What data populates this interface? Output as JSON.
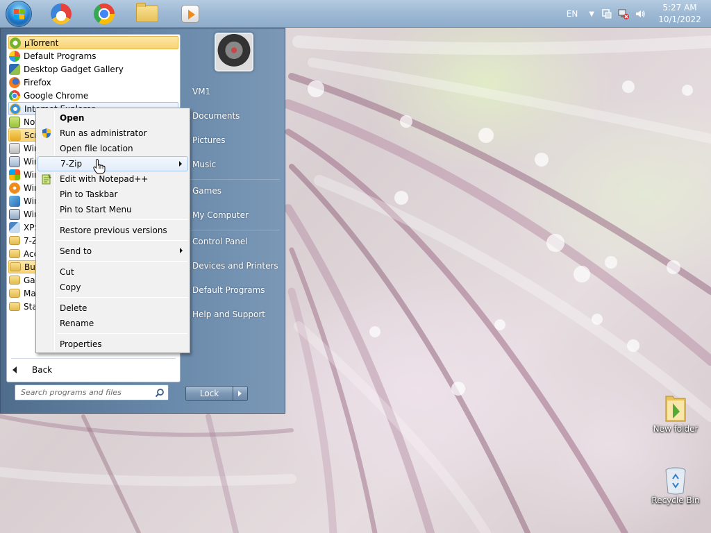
{
  "taskbar": {
    "apps": [
      {
        "name": "start-button",
        "icon": "windows-orb-icon"
      },
      {
        "name": "browser-lock-app",
        "icon": "lock-browser-icon"
      },
      {
        "name": "chrome-app",
        "icon": "chrome-icon"
      },
      {
        "name": "explorer-app",
        "icon": "folder-icon"
      },
      {
        "name": "media-player-app",
        "icon": "media-player-icon"
      }
    ],
    "tray": {
      "language": "EN",
      "time": "5:27 AM",
      "date": "10/1/2022",
      "icons": [
        "show-hidden-icons-chevron",
        "action-center-icon",
        "network-disconnected-icon",
        "volume-icon"
      ]
    }
  },
  "start_menu": {
    "programs": [
      {
        "label": "µTorrent",
        "icon": "utorrent-icon",
        "state": "highlighted"
      },
      {
        "label": "Default Programs",
        "icon": "default-programs-icon"
      },
      {
        "label": "Desktop Gadget Gallery",
        "icon": "gadget-gallery-icon"
      },
      {
        "label": "Firefox",
        "icon": "firefox-icon"
      },
      {
        "label": "Google Chrome",
        "icon": "chrome-icon"
      },
      {
        "label": "Internet Explorer",
        "icon": "internet-explorer-icon",
        "state": "selected"
      },
      {
        "label": "Not",
        "icon": "notepad-icon"
      },
      {
        "label": "Scr",
        "icon": "scratch-icon",
        "state": "highlighted"
      },
      {
        "label": "Win",
        "icon": "windows-app-icon"
      },
      {
        "label": "Win",
        "icon": "windows-app-icon"
      },
      {
        "label": "Win",
        "icon": "windows-app-icon"
      },
      {
        "label": "Win",
        "icon": "windows-media-icon"
      },
      {
        "label": "Win",
        "icon": "windows-app-icon"
      },
      {
        "label": "Win",
        "icon": "windows-app-icon"
      },
      {
        "label": "XPS",
        "icon": "xps-viewer-icon"
      },
      {
        "label": "7-Z",
        "icon": "folder-icon"
      },
      {
        "label": "Acc",
        "icon": "folder-icon"
      },
      {
        "label": "But",
        "icon": "folder-icon",
        "state": "highlighted"
      },
      {
        "label": "Gar",
        "icon": "folder-icon"
      },
      {
        "label": "Ma",
        "icon": "folder-icon"
      },
      {
        "label": "Sta",
        "icon": "folder-icon"
      }
    ],
    "back_label": "Back",
    "search_placeholder": "Search programs and files",
    "right_items": [
      {
        "label": "VM1"
      },
      {
        "label": "Documents"
      },
      {
        "label": "Pictures"
      },
      {
        "label": "Music"
      },
      {
        "label": "Games"
      },
      {
        "label": "My Computer"
      },
      {
        "label": "Control Panel"
      },
      {
        "label": "Devices and Printers"
      },
      {
        "label": "Default Programs"
      },
      {
        "label": "Help and Support"
      }
    ],
    "lock_label": "Lock"
  },
  "context_menu": {
    "items": [
      {
        "label": "Open",
        "bold": true
      },
      {
        "label": "Run as administrator",
        "icon": "uac-shield-icon"
      },
      {
        "label": "Open file location"
      },
      {
        "label": "7-Zip",
        "submenu": true,
        "state": "hover"
      },
      {
        "label": "Edit with Notepad++",
        "icon": "notepad-plus-plus-icon"
      },
      {
        "label": "Pin to Taskbar"
      },
      {
        "label": "Pin to Start Menu"
      },
      {
        "label": "Restore previous versions"
      },
      {
        "label": "Send to",
        "submenu": true
      },
      {
        "label": "Cut"
      },
      {
        "label": "Copy"
      },
      {
        "label": "Delete"
      },
      {
        "label": "Rename"
      },
      {
        "label": "Properties"
      }
    ]
  },
  "desktop": {
    "icons": [
      {
        "label": "New folder",
        "icon": "folder-icon"
      },
      {
        "label": "Recycle Bin",
        "icon": "recycle-bin-icon"
      }
    ]
  },
  "colors": {
    "taskbar": "#9db8d3",
    "start_menu_right": "#6a8aab",
    "highlight": "#f8d374",
    "context_hover": "#e2ecf9"
  }
}
